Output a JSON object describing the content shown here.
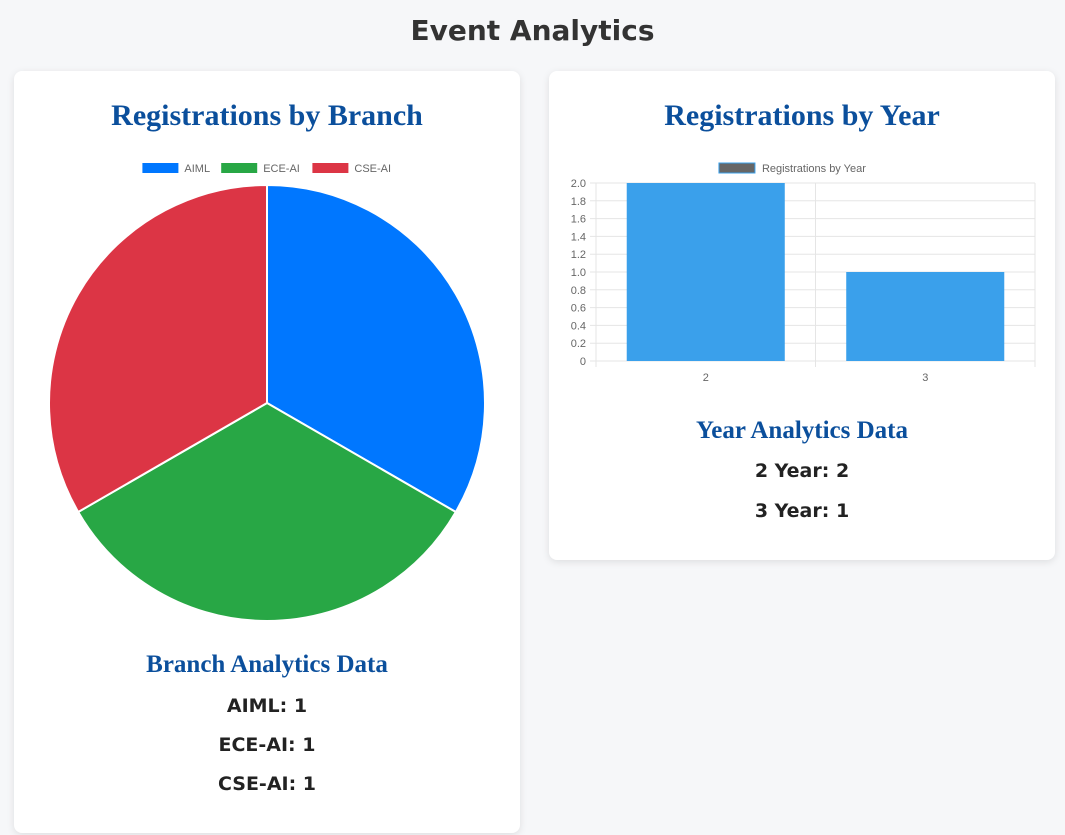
{
  "page": {
    "title": "Event Analytics"
  },
  "branch_card": {
    "title": "Registrations by Branch",
    "data_title": "Branch Analytics Data",
    "lines": [
      "AIML: 1",
      "ECE-AI: 1",
      "CSE-AI: 1"
    ]
  },
  "year_card": {
    "title": "Registrations by Year",
    "data_title": "Year Analytics Data",
    "lines": [
      "2 Year: 2",
      "3 Year: 1"
    ]
  },
  "chart_data": [
    {
      "type": "pie",
      "labels": [
        "AIML",
        "ECE-AI",
        "CSE-AI"
      ],
      "values": [
        1,
        1,
        1
      ],
      "colors": [
        "#0077ff",
        "#28a745",
        "#dc3545"
      ],
      "legend": "top"
    },
    {
      "type": "bar",
      "categories": [
        "2",
        "3"
      ],
      "series": [
        {
          "name": "Registrations by Year",
          "values": [
            2,
            1
          ]
        }
      ],
      "ylim": [
        0,
        2.0
      ],
      "yticks": [
        "0",
        "0.2",
        "0.4",
        "0.6",
        "0.8",
        "1.0",
        "1.2",
        "1.4",
        "1.6",
        "1.8",
        "2.0"
      ],
      "bar_color": "#3aa0eb",
      "legend_swatch_color": "#666666",
      "grid": true,
      "legend": "top"
    }
  ]
}
